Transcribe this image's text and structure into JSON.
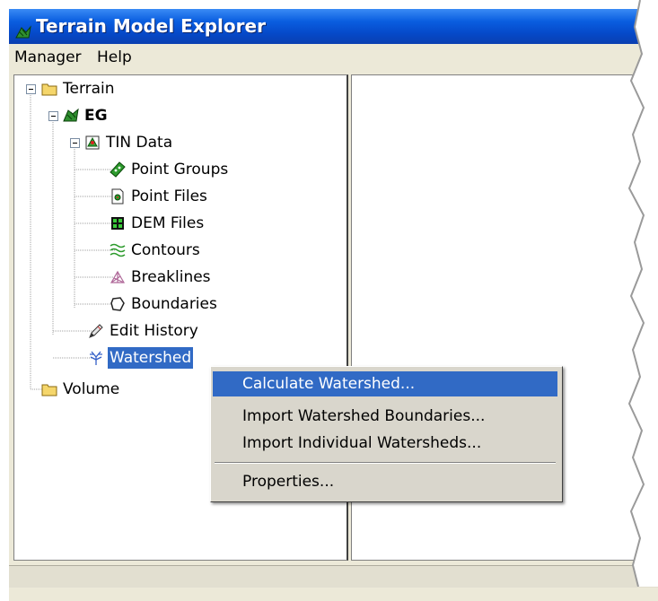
{
  "window": {
    "title": "Terrain Model Explorer",
    "title_icon": "terrain-explorer-icon"
  },
  "menubar": {
    "items": [
      "Manager",
      "Help"
    ]
  },
  "tree": {
    "nodes": [
      {
        "label": "Terrain",
        "icon": "folder-icon",
        "expander": "minus"
      },
      {
        "label": "EG",
        "icon": "surface-icon",
        "expander": "minus"
      },
      {
        "label": "TIN Data",
        "icon": "tin-data-icon",
        "expander": "minus"
      },
      {
        "label": "Point Groups",
        "icon": "point-groups-icon"
      },
      {
        "label": "Point Files",
        "icon": "point-files-icon"
      },
      {
        "label": "DEM Files",
        "icon": "dem-files-icon"
      },
      {
        "label": "Contours",
        "icon": "contours-icon"
      },
      {
        "label": "Breaklines",
        "icon": "breaklines-icon"
      },
      {
        "label": "Boundaries",
        "icon": "boundaries-icon"
      },
      {
        "label": "Edit History",
        "icon": "edit-history-icon"
      },
      {
        "label": "Watershed",
        "icon": "watershed-icon",
        "selected": true
      },
      {
        "label": "Volume",
        "icon": "folder-icon"
      }
    ]
  },
  "context_menu": {
    "items": [
      {
        "label": "Calculate Watershed...",
        "highlighted": true
      },
      {
        "label": "Import Watershed Boundaries..."
      },
      {
        "label": "Import Individual Watersheds..."
      },
      {
        "label": "Properties..."
      }
    ]
  },
  "colors": {
    "title_bar": "#0a5ee0",
    "selection": "#316ac5",
    "menu_bg": "#d9d6cc"
  }
}
